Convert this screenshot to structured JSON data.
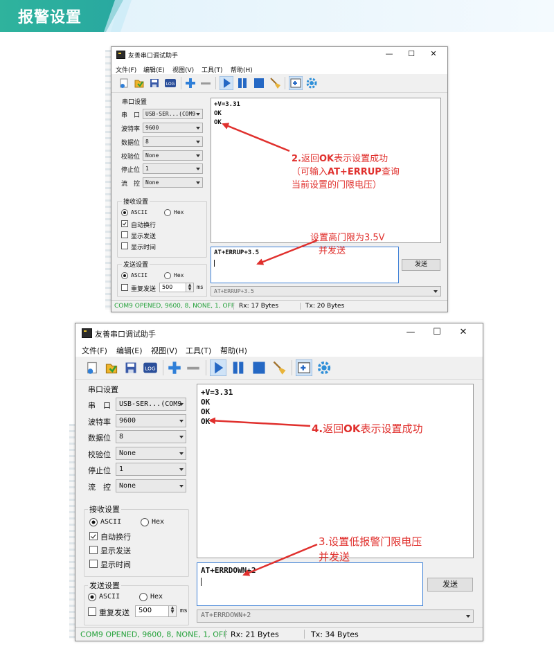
{
  "banner": {
    "title": "报警设置"
  },
  "colors": {
    "banner": "#2fb39d",
    "annotation": "#e0302d",
    "status_ok": "#22a038",
    "send_border": "#3c7fd6"
  },
  "windows": [
    {
      "title": "友善串口调试助手",
      "controls": {
        "min": "—",
        "max": "☐",
        "close": "✕"
      },
      "menu": [
        "文件(F)",
        "编辑(E)",
        "视图(V)",
        "工具(T)",
        "帮助(H)"
      ],
      "serial_group": {
        "title": "串口设置",
        "port_label": "串　口",
        "port_value": "USB-SER...(COM9",
        "baud_label": "波特率",
        "baud_value": "9600",
        "data_label": "数据位",
        "data_value": "8",
        "parity_label": "校验位",
        "parity_value": "None",
        "stop_label": "停止位",
        "stop_value": "1",
        "flow_label": "流　控",
        "flow_value": "None"
      },
      "recv_group": {
        "title": "接收设置",
        "ascii": "ASCII",
        "hex": "Hex",
        "auto_wrap": "自动换行",
        "show_send": "显示发送",
        "show_time": "显示时间"
      },
      "send_group": {
        "title": "发送设置",
        "ascii": "ASCII",
        "hex": "Hex",
        "repeat": "重复发送",
        "interval": "500",
        "unit": "ms"
      },
      "receive_text": [
        "+V=3.31",
        "OK",
        "OK"
      ],
      "send_text": "AT+ERRUP+3.5",
      "send_button": "发送",
      "history": "AT+ERRUP+3.5",
      "status": {
        "port": "COM9 OPENED, 9600, 8, NONE, 1, OFF",
        "rx": "Rx: 17 Bytes",
        "tx": "Tx: 20 Bytes"
      },
      "annotations": [
        {
          "prefix": "2.",
          "body": "返回",
          "bold": "OK",
          "suffix": "表示设置成功"
        },
        {
          "prefix": "（可输入",
          "bold": "AT+ERRUP",
          "suffix": "查询"
        },
        {
          "text": "当前设置的门限电压）"
        },
        {
          "text": "设置高门限为3.5V"
        },
        {
          "text": "并发送"
        }
      ]
    },
    {
      "title": "友善串口调试助手",
      "controls": {
        "min": "—",
        "max": "☐",
        "close": "✕"
      },
      "menu": [
        "文件(F)",
        "编辑(E)",
        "视图(V)",
        "工具(T)",
        "帮助(H)"
      ],
      "serial_group": {
        "title": "串口设置",
        "port_label": "串　口",
        "port_value": "USB-SER...(COM9",
        "baud_label": "波特率",
        "baud_value": "9600",
        "data_label": "数据位",
        "data_value": "8",
        "parity_label": "校验位",
        "parity_value": "None",
        "stop_label": "停止位",
        "stop_value": "1",
        "flow_label": "流　控",
        "flow_value": "None"
      },
      "recv_group": {
        "title": "接收设置",
        "ascii": "ASCII",
        "hex": "Hex",
        "auto_wrap": "自动换行",
        "show_send": "显示发送",
        "show_time": "显示时间"
      },
      "send_group": {
        "title": "发送设置",
        "ascii": "ASCII",
        "hex": "Hex",
        "repeat": "重复发送",
        "interval": "500",
        "unit": "ms"
      },
      "receive_text": [
        "+V=3.31",
        "OK",
        "OK",
        "OK"
      ],
      "send_text": "AT+ERRDOWN+2",
      "send_button": "发送",
      "history": "AT+ERRDOWN+2",
      "status": {
        "port": "COM9 OPENED, 9600, 8, NONE, 1, OFF",
        "rx": "Rx: 21 Bytes",
        "tx": "Tx: 34 Bytes"
      },
      "annotations": [
        {
          "prefix": "4.",
          "body": "返回",
          "bold": "OK",
          "suffix": "表示设置成功"
        },
        {
          "text": "3.设置低报警门限电压"
        },
        {
          "text": "并发送"
        }
      ]
    }
  ]
}
